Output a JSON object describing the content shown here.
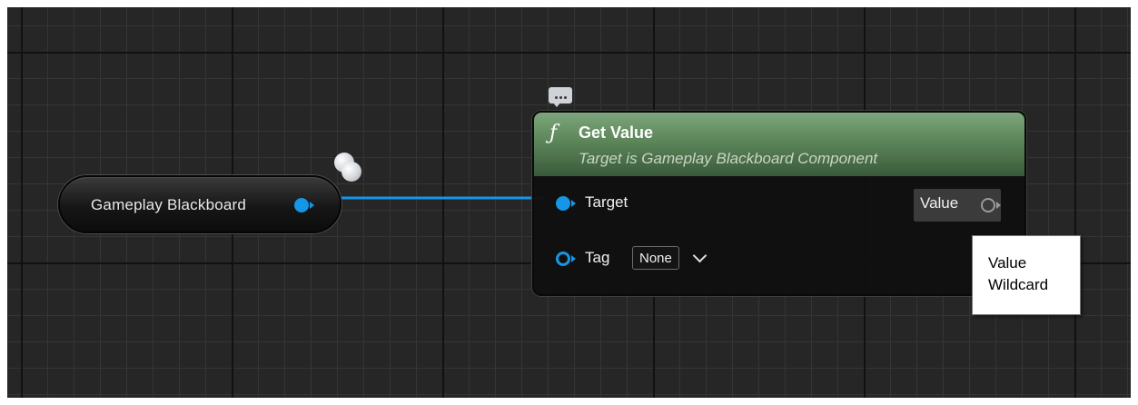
{
  "graph": {
    "variable_node": {
      "label": "Gameplay Blackboard",
      "pin_color": "#1596e6"
    },
    "function_node": {
      "icon": "function-icon",
      "title": "Get Value",
      "subtitle": "Target is Gameplay Blackboard Component",
      "header_color": "#6a9466",
      "inputs": {
        "target_label": "Target",
        "tag_label": "Tag",
        "tag_value": "None"
      },
      "outputs": {
        "value_label": "Value"
      }
    },
    "tooltip": {
      "line1": "Value",
      "line2": "Wildcard"
    },
    "comment_icon": "comment-bubble-icon"
  }
}
